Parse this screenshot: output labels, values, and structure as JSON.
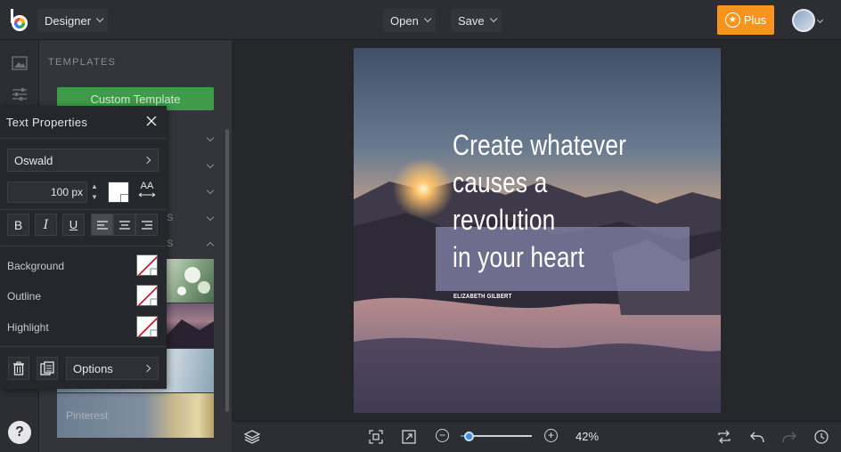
{
  "topbar": {
    "mode_label": "Designer",
    "open_label": "Open",
    "save_label": "Save",
    "plus_label": "Plus",
    "accent_color": "#f7941d"
  },
  "templates_panel": {
    "title": "TEMPLATES",
    "custom_template_label": "Custom Template",
    "section_fragments": [
      "S",
      "S"
    ],
    "thumbnails": [
      {
        "label": "",
        "name": "floral"
      },
      {
        "label": "",
        "name": "mountain"
      },
      {
        "label": "",
        "name": "portrait"
      },
      {
        "label": "Pinterest",
        "name": "food"
      }
    ]
  },
  "text_properties": {
    "title": "Text Properties",
    "font_name": "Oswald",
    "font_size": "100 px",
    "text_color": "#ffffff",
    "format_buttons": {
      "bold": "B",
      "italic": "I",
      "underline": "U"
    },
    "aa_label": "AA",
    "rows": {
      "background": "Background",
      "outline": "Outline",
      "highlight": "Highlight"
    },
    "options_label": "Options"
  },
  "artboard": {
    "quote_lines": [
      "Create whatever",
      "causes a",
      "revolution",
      "in your heart"
    ],
    "author": "ELIZABETH GILBERT",
    "highlight_color": "#9696c3"
  },
  "bottombar": {
    "zoom_value": "42%",
    "zoom_fraction": 0.1
  },
  "help_label": "?"
}
